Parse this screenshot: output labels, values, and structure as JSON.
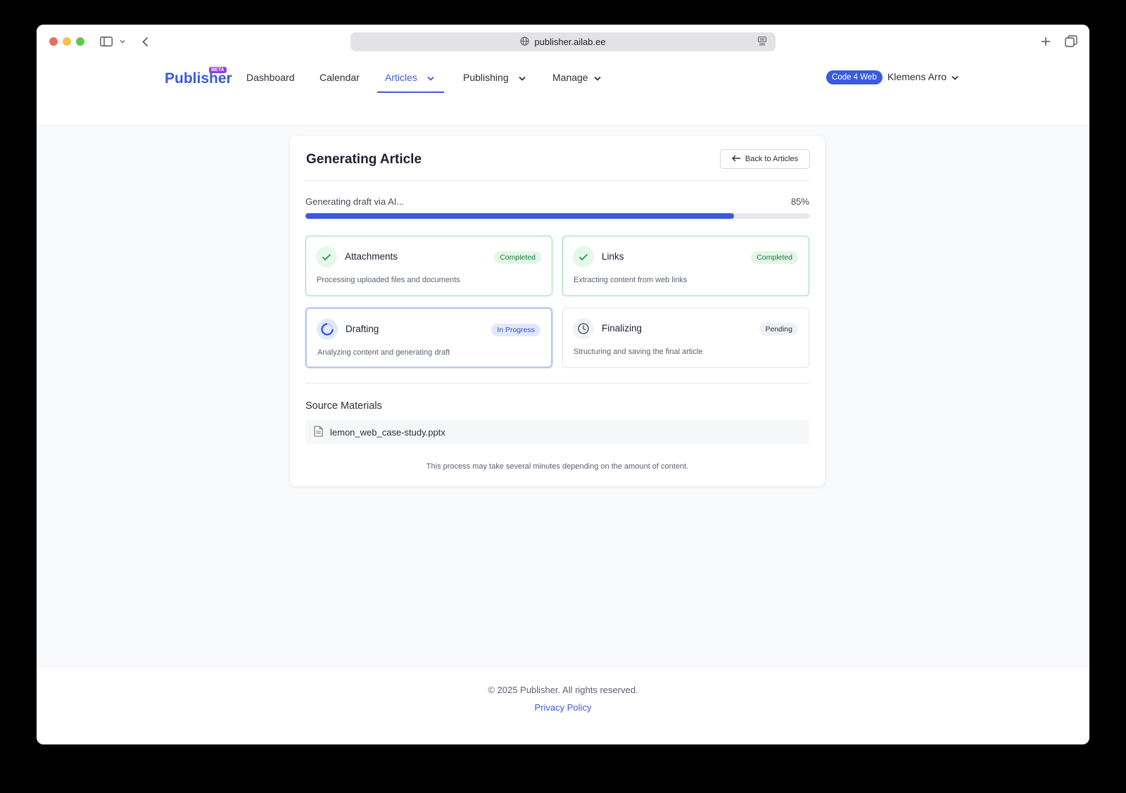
{
  "browser": {
    "url": "publisher.ailab.ee"
  },
  "nav": {
    "logo": "Publisher",
    "beta": "BETA",
    "items": [
      {
        "label": "Dashboard"
      },
      {
        "label": "Calendar"
      },
      {
        "label": "Articles"
      },
      {
        "label": "Publishing"
      },
      {
        "label": "Manage"
      }
    ],
    "org": "Code 4 Web",
    "user": "Klemens Arro"
  },
  "card": {
    "title": "Generating Article",
    "back_label": "Back to Articles",
    "progress_label": "Generating draft via AI...",
    "progress_text": "85%",
    "progress_value": 0.85,
    "steps": [
      {
        "title": "Attachments",
        "status": "Completed",
        "desc": "Processing uploaded files and documents",
        "icon": "check-icon"
      },
      {
        "title": "Links",
        "status": "Completed",
        "desc": "Extracting content from web links",
        "icon": "check-icon"
      },
      {
        "title": "Drafting",
        "status": "In Progress",
        "desc": "Analyzing content and generating draft",
        "icon": "spinner-icon"
      },
      {
        "title": "Finalizing",
        "status": "Pending",
        "desc": "Structuring and saving the final article",
        "icon": "clock-icon"
      }
    ],
    "source_title": "Source Materials",
    "source_file": "lemon_web_case-study.pptx",
    "note": "This process may take several minutes depending on the amount of content."
  },
  "footer": {
    "copyright": "© 2025 Publisher. All rights reserved.",
    "privacy": "Privacy Policy"
  },
  "colors": {
    "accent": "#3b5bdb",
    "success": "#1f7a3b",
    "beta": "#8b3fe0"
  }
}
